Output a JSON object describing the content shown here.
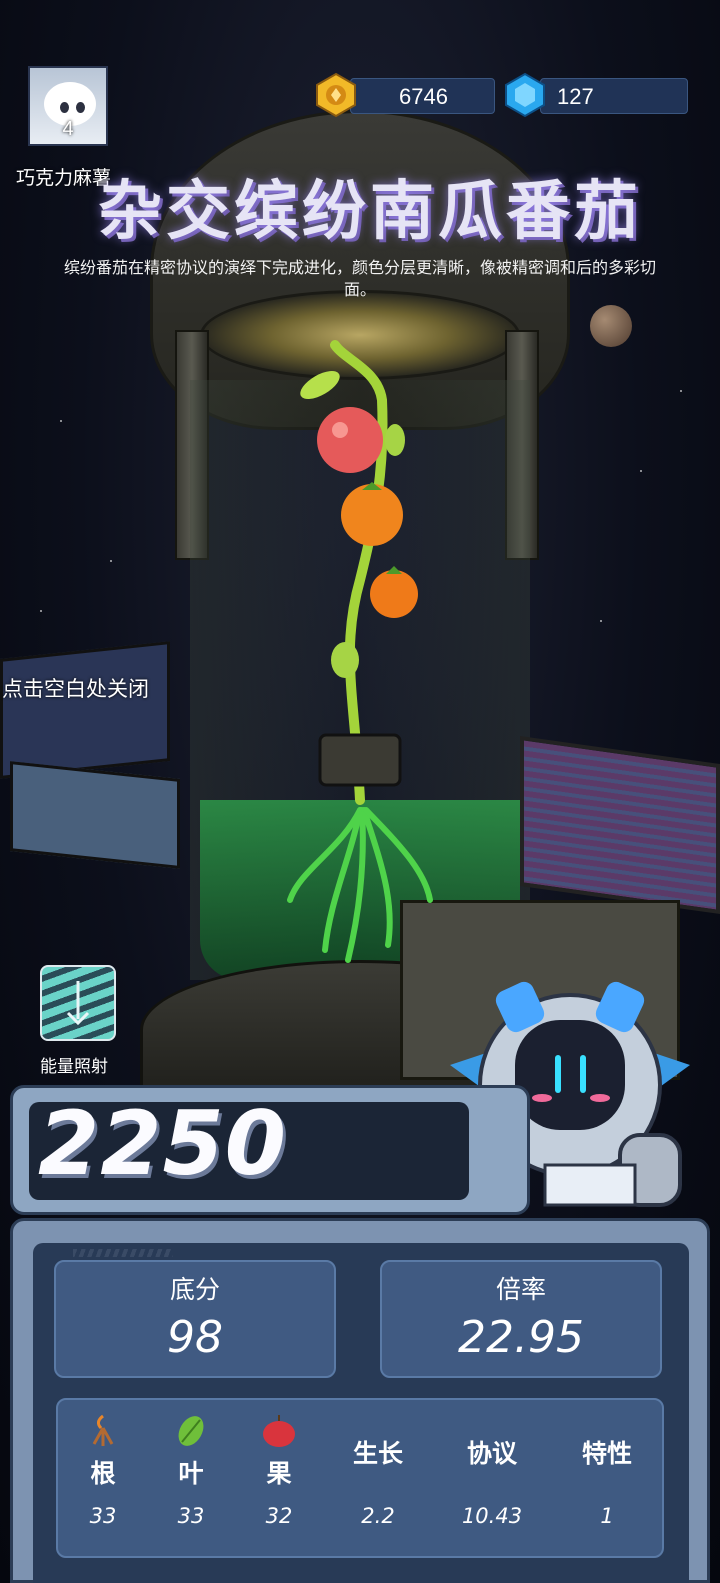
{
  "player": {
    "name": "巧克力麻薯",
    "level": "4"
  },
  "resources": {
    "gold": "6746",
    "gems": "127"
  },
  "plant": {
    "title": "杂交缤纷南瓜番茄",
    "description": "缤纷番茄在精密协议的演绎下完成进化，颜色分层更清晰，像被精密调和后的多彩切面。"
  },
  "hint": {
    "close": "点击空白处关闭"
  },
  "energy": {
    "label": "能量照射"
  },
  "score": {
    "total": "2250"
  },
  "stats": {
    "base_label": "底分",
    "base_value": "98",
    "multiplier_label": "倍率",
    "multiplier_value": "22.95"
  },
  "attributes": [
    {
      "label": "根",
      "value": "33",
      "icon": "root-icon"
    },
    {
      "label": "叶",
      "value": "33",
      "icon": "leaf-icon"
    },
    {
      "label": "果",
      "value": "32",
      "icon": "fruit-icon"
    },
    {
      "label": "生长",
      "value": "2.2"
    },
    {
      "label": "协议",
      "value": "10.43"
    },
    {
      "label": "特性",
      "value": "1"
    }
  ],
  "colors": {
    "panel": "#283a56",
    "stat_box": "#405a82",
    "accent_gold": "#f2b928",
    "accent_gem": "#2aa8ef"
  }
}
